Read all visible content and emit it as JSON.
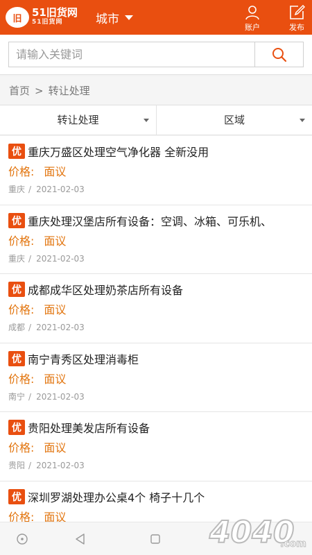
{
  "header": {
    "logo_mark": "旧",
    "logo_text": "51旧货网",
    "logo_sub": "51旧货网",
    "city_label": "城市",
    "account_label": "账户",
    "publish_label": "发布",
    "brand_color": "#e94f10"
  },
  "search": {
    "placeholder": "请输入关键词",
    "icon": "search-icon"
  },
  "breadcrumb": {
    "home": "首页",
    "sep": ">",
    "current": "转让处理"
  },
  "filters": [
    {
      "label": "转让处理"
    },
    {
      "label": "区域"
    }
  ],
  "listings": [
    {
      "badge": "优",
      "title": "重庆万盛区处理空气净化器 全新没用",
      "price_label": "价格:",
      "price": "面议",
      "city": "重庆",
      "slash": "/",
      "date": "2021-02-03"
    },
    {
      "badge": "优",
      "title": "重庆处理汉堡店所有设备：空调、冰箱、可乐机、",
      "price_label": "价格:",
      "price": "面议",
      "city": "重庆",
      "slash": "/",
      "date": "2021-02-03"
    },
    {
      "badge": "优",
      "title": "成都成华区处理奶茶店所有设备",
      "price_label": "价格:",
      "price": "面议",
      "city": "成都",
      "slash": "/",
      "date": "2021-02-03"
    },
    {
      "badge": "优",
      "title": "南宁青秀区处理消毒柜",
      "price_label": "价格:",
      "price": "面议",
      "city": "南宁",
      "slash": "/",
      "date": "2021-02-03"
    },
    {
      "badge": "优",
      "title": "贵阳处理美发店所有设备",
      "price_label": "价格:",
      "price": "面议",
      "city": "贵阳",
      "slash": "/",
      "date": "2021-02-03"
    },
    {
      "badge": "优",
      "title": "深圳罗湖处理办公桌4个 椅子十几个",
      "price_label": "价格:",
      "price": "面议",
      "city": "",
      "slash": "",
      "date": ""
    }
  ],
  "colors": {
    "price": "#e2740d",
    "badge": "#e94f10"
  },
  "watermark": {
    "text": "4040",
    "suffix": ".com"
  }
}
